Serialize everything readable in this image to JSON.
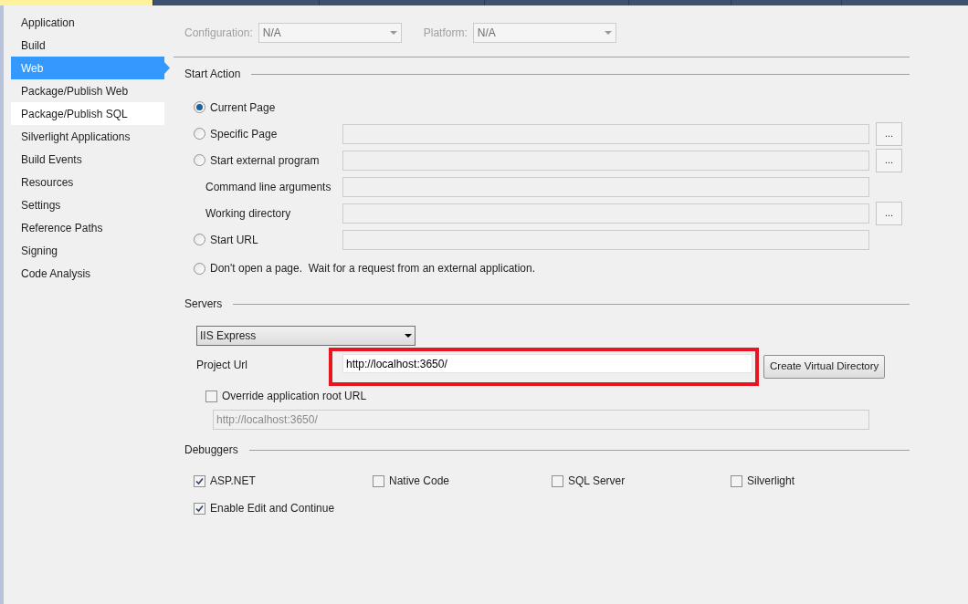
{
  "tabs": [
    {
      "selected": true
    },
    {
      "selected": false
    },
    {
      "selected": false
    },
    {
      "selected": false
    },
    {
      "selected": false
    },
    {
      "selected": false
    },
    {
      "selected": false
    }
  ],
  "sidebar": {
    "items": [
      {
        "label": "Application",
        "selected": false,
        "hovered": false
      },
      {
        "label": "Build",
        "selected": false,
        "hovered": false
      },
      {
        "label": "Web",
        "selected": true,
        "hovered": false
      },
      {
        "label": "Package/Publish Web",
        "selected": false,
        "hovered": false
      },
      {
        "label": "Package/Publish SQL",
        "selected": false,
        "hovered": true
      },
      {
        "label": "Silverlight Applications",
        "selected": false,
        "hovered": false
      },
      {
        "label": "Build Events",
        "selected": false,
        "hovered": false
      },
      {
        "label": "Resources",
        "selected": false,
        "hovered": false
      },
      {
        "label": "Settings",
        "selected": false,
        "hovered": false
      },
      {
        "label": "Reference Paths",
        "selected": false,
        "hovered": false
      },
      {
        "label": "Signing",
        "selected": false,
        "hovered": false
      },
      {
        "label": "Code Analysis",
        "selected": false,
        "hovered": false
      }
    ]
  },
  "configuration": {
    "label": "Configuration:",
    "value": "N/A",
    "disabled": true
  },
  "platform": {
    "label": "Platform:",
    "value": "N/A",
    "disabled": true
  },
  "start_action": {
    "title": "Start Action",
    "options": [
      {
        "kind": "radio",
        "label": "Current Page",
        "selected": true
      },
      {
        "kind": "radio-field",
        "label": "Specific Page",
        "selected": false,
        "browse": "..."
      },
      {
        "kind": "radio-field",
        "label": "Start external program",
        "selected": false,
        "browse": "..."
      },
      {
        "kind": "field",
        "label": "Command line arguments"
      },
      {
        "kind": "field",
        "label": "Working directory",
        "browse": "..."
      },
      {
        "kind": "radio-field",
        "label": "Start URL",
        "selected": false
      },
      {
        "kind": "radio",
        "label": "Don't open a page.  Wait for a request from an external application.",
        "selected": false
      }
    ]
  },
  "servers": {
    "title": "Servers",
    "server": "IIS Express",
    "project_url_label": "Project Url",
    "project_url": "http://localhost:3650/",
    "highlighted": true,
    "create_button": "Create Virtual Directory",
    "override": {
      "label": "Override application root URL",
      "checked": false
    },
    "override_url": "http://localhost:3650/"
  },
  "debuggers": {
    "title": "Debuggers",
    "items": [
      {
        "label": "ASP.NET",
        "checked": true
      },
      {
        "label": "Native Code",
        "checked": false
      },
      {
        "label": "SQL Server",
        "checked": false
      },
      {
        "label": "Silverlight",
        "checked": false
      }
    ],
    "edit_continue": {
      "label": "Enable Edit and Continue",
      "checked": true
    }
  }
}
